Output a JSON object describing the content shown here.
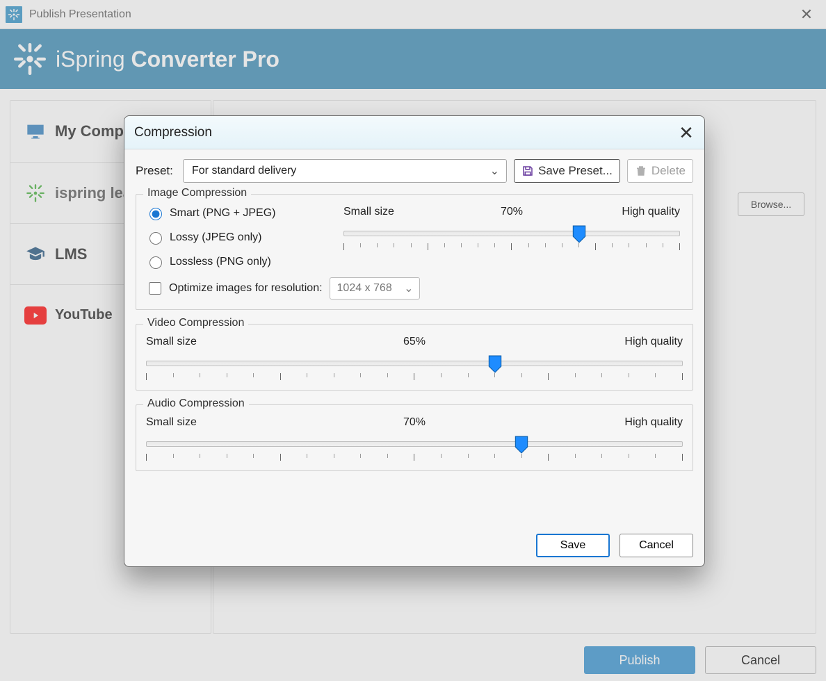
{
  "window": {
    "title": "Publish Presentation",
    "banner_text_light": "iSpring ",
    "banner_text_bold": "Converter Pro"
  },
  "sidebar": {
    "items": [
      {
        "label": "My Computer"
      },
      {
        "label": "ispring learn"
      },
      {
        "label": "LMS"
      },
      {
        "label": "YouTube"
      }
    ]
  },
  "background": {
    "browse_label": "Browse..."
  },
  "bottom": {
    "publish": "Publish",
    "cancel": "Cancel"
  },
  "modal": {
    "title": "Compression",
    "preset_label": "Preset:",
    "preset_value": "For standard delivery",
    "save_preset": "Save Preset...",
    "delete": "Delete",
    "image": {
      "group": "Image Compression",
      "radios": {
        "smart": "Smart (PNG + JPEG)",
        "lossy": "Lossy (JPEG only)",
        "lossless": "Lossless (PNG only)"
      },
      "optimise_label": "Optimize images for resolution:",
      "resolution": "1024 x 768",
      "slider": {
        "low": "Small size",
        "value": "70%",
        "high": "High quality",
        "pos": 70
      }
    },
    "video": {
      "group": "Video Compression",
      "slider": {
        "low": "Small size",
        "value": "65%",
        "high": "High quality",
        "pos": 65
      }
    },
    "audio": {
      "group": "Audio Compression",
      "slider": {
        "low": "Small size",
        "value": "70%",
        "high": "High quality",
        "pos": 70
      }
    },
    "footer": {
      "save": "Save",
      "cancel": "Cancel"
    }
  }
}
